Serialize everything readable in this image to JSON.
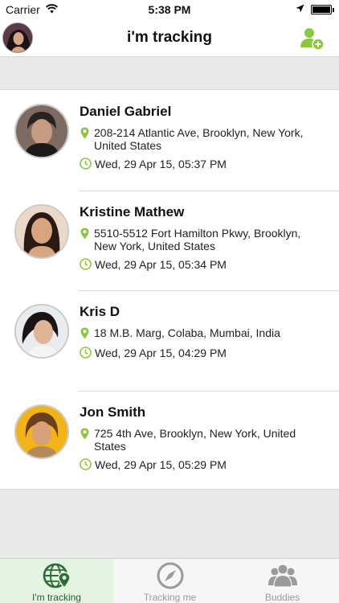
{
  "status_bar": {
    "carrier": "Carrier",
    "time": "5:38 PM"
  },
  "header": {
    "title": "i'm tracking"
  },
  "contacts": [
    {
      "name": "Daniel Gabriel",
      "address": "208-214 Atlantic Ave, Brooklyn, New York, United States",
      "time": "Wed, 29 Apr 15, 05:37 PM"
    },
    {
      "name": "Kristine Mathew",
      "address": "5510-5512 Fort Hamilton Pkwy, Brooklyn, New York, United States",
      "time": "Wed, 29 Apr 15, 05:34 PM"
    },
    {
      "name": "Kris D",
      "address": "18 M.B. Marg, Colaba, Mumbai, India",
      "time": "Wed, 29 Apr 15, 04:29 PM"
    },
    {
      "name": "Jon Smith",
      "address": "725 4th Ave, Brooklyn, New York, United States",
      "time": "Wed, 29 Apr 15, 05:29 PM"
    }
  ],
  "tabs": [
    {
      "label": "I'm tracking",
      "icon": "globe-pin-icon",
      "active": true
    },
    {
      "label": "Tracking me",
      "icon": "compass-icon",
      "active": false
    },
    {
      "label": "Buddies",
      "icon": "group-icon",
      "active": false
    }
  ],
  "colors": {
    "accent": "#8dc63f",
    "tab_active_bg": "#e4f3e2",
    "tab_active_icon": "#2e6b3a"
  }
}
